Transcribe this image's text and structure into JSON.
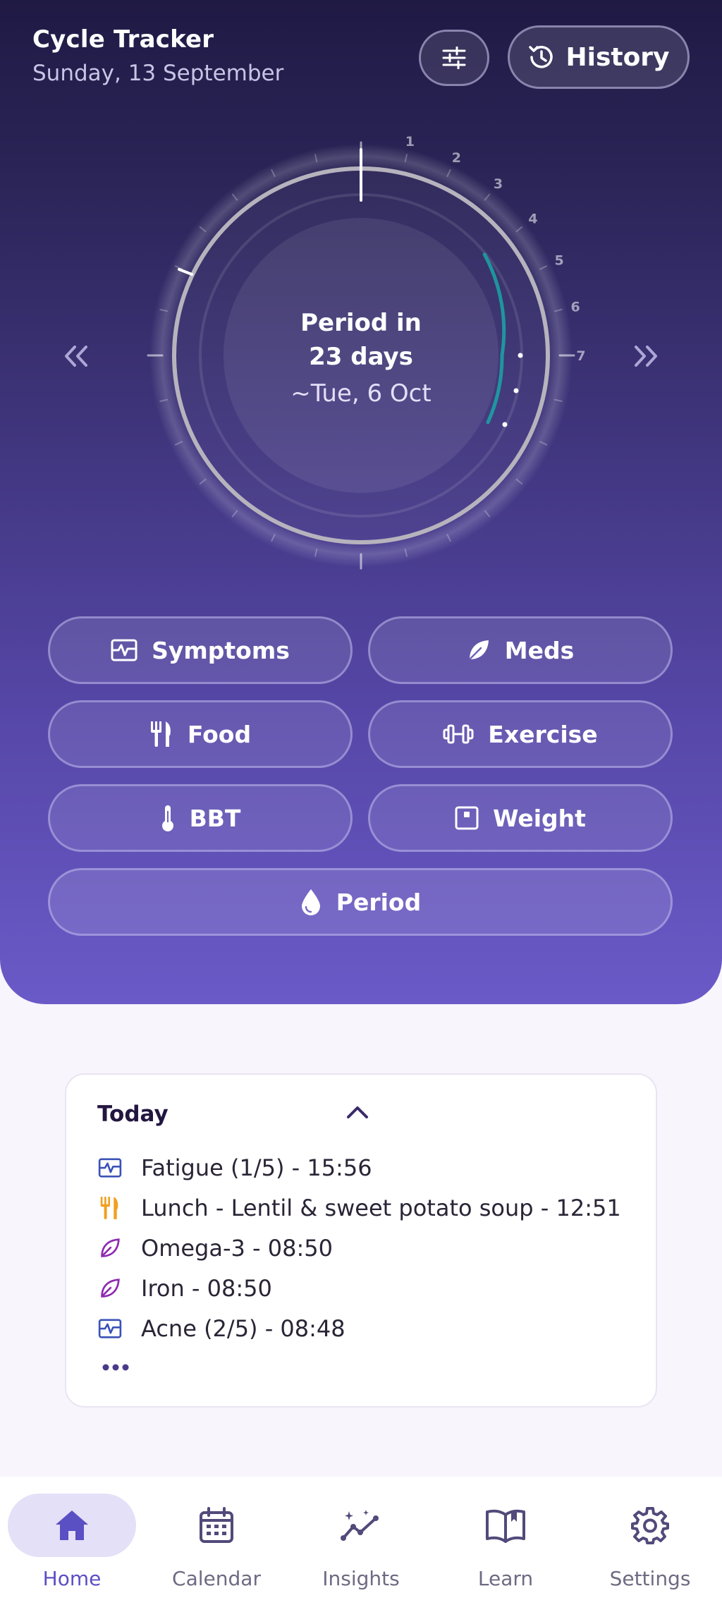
{
  "header": {
    "title": "Cycle Tracker",
    "date": "Sunday, 13 September",
    "history_label": "History"
  },
  "dial": {
    "line1": "Period in",
    "line2": "23 days",
    "line3": "~Tue, 6 Oct",
    "day_labels": [
      "1",
      "2",
      "3",
      "4",
      "5",
      "6",
      "7"
    ]
  },
  "log_buttons": {
    "symptoms": "Symptoms",
    "meds": "Meds",
    "food": "Food",
    "exercise": "Exercise",
    "bbt": "BBT",
    "weight": "Weight",
    "period": "Period"
  },
  "today": {
    "title": "Today",
    "entries": [
      {
        "text": "Fatigue (1/5) - 15:56",
        "icon": "symptoms-icon"
      },
      {
        "text": "Lunch - Lentil & sweet potato soup - 12:51",
        "icon": "food-icon"
      },
      {
        "text": "Omega-3 - 08:50",
        "icon": "meds-icon"
      },
      {
        "text": "Iron - 08:50",
        "icon": "meds-icon"
      },
      {
        "text": "Acne (2/5) - 08:48",
        "icon": "symptoms-icon"
      }
    ]
  },
  "bottom_nav": {
    "home": "Home",
    "calendar": "Calendar",
    "insights": "Insights",
    "learn": "Learn",
    "settings": "Settings"
  },
  "colors": {
    "accent": "#5b4fc4",
    "food_icon": "#f0a020",
    "meds_icon": "#8e2ab0",
    "symptoms_icon": "#3a52b8"
  }
}
